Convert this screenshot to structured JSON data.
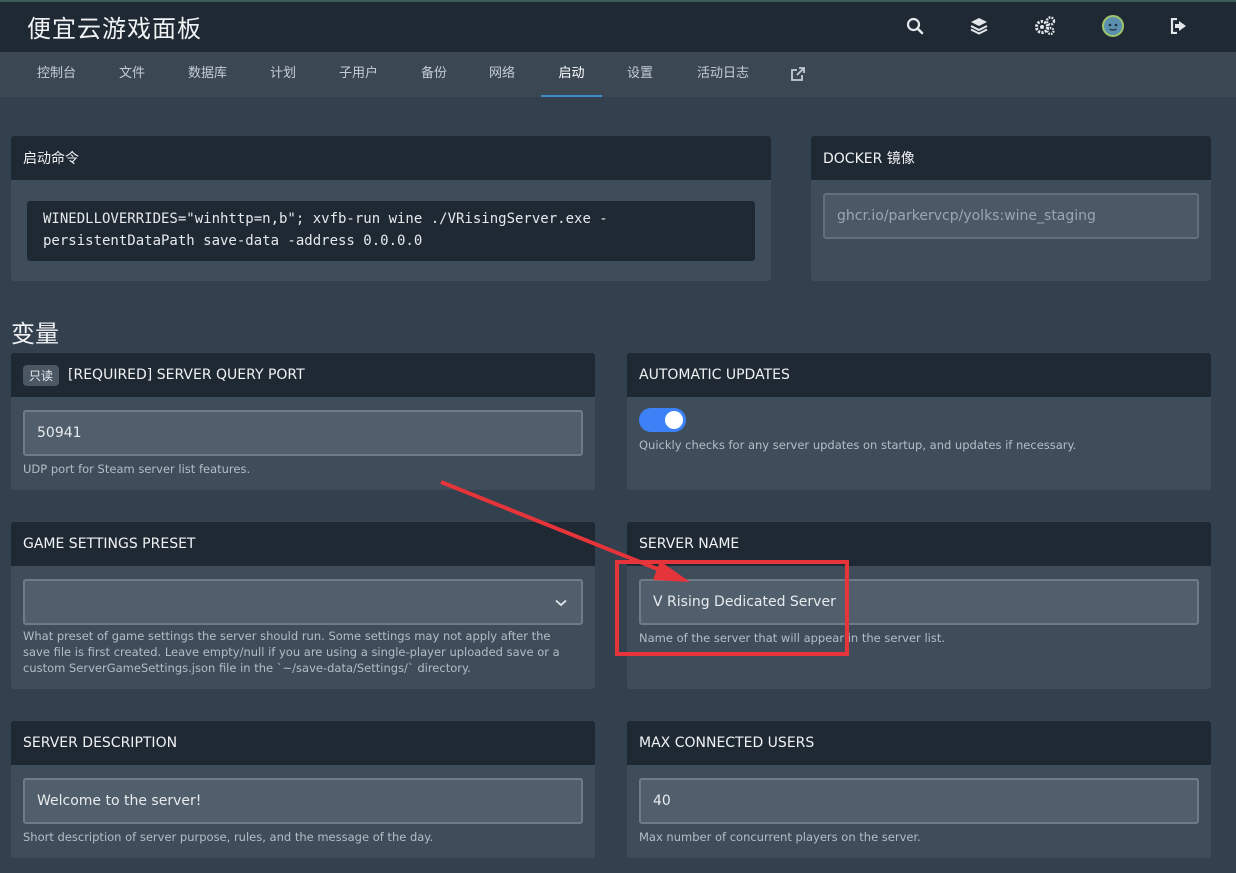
{
  "header": {
    "brand": "便宜云游戏面板",
    "icons": [
      "search-icon",
      "layers-icon",
      "cogs-icon",
      "avatar-icon",
      "logout-icon"
    ]
  },
  "nav": {
    "tabs": [
      {
        "label": "控制台"
      },
      {
        "label": "文件"
      },
      {
        "label": "数据库"
      },
      {
        "label": "计划"
      },
      {
        "label": "子用户"
      },
      {
        "label": "备份"
      },
      {
        "label": "网络"
      },
      {
        "label": "启动",
        "active": true
      },
      {
        "label": "设置"
      },
      {
        "label": "活动日志"
      }
    ],
    "external_icon": "external-link-icon"
  },
  "startup": {
    "title": "启动命令",
    "command_line1": "WINEDLLOVERRIDES=\"winhttp=n,b\"; xvfb-run wine ./VRisingServer.exe -",
    "command_line2": "persistentDataPath save-data -address 0.0.0.0"
  },
  "docker": {
    "title": "DOCKER 镜像",
    "image": "ghcr.io/parkervcp/yolks:wine_staging"
  },
  "variables": {
    "title": "变量",
    "query_port": {
      "badge": "只读",
      "label": "[REQUIRED] SERVER QUERY PORT",
      "value": "50941",
      "help": "UDP port for Steam server list features."
    },
    "auto_updates": {
      "label": "AUTOMATIC UPDATES",
      "enabled": true,
      "help": "Quickly checks for any server updates on startup, and updates if necessary."
    },
    "game_preset": {
      "label": "GAME SETTINGS PRESET",
      "value": "",
      "help_line1": "What preset of game settings the server should run. Some settings may not apply after the",
      "help_line2": "save file is first created. Leave empty/null if you are using a single-player uploaded save or a",
      "help_line3": "custom ServerGameSettings.json file in the `~/save-data/Settings/` directory."
    },
    "server_name": {
      "label": "SERVER NAME",
      "value": "V Rising Dedicated Server",
      "help": "Name of the server that will appear in the server list."
    },
    "server_description": {
      "label": "SERVER DESCRIPTION",
      "value": "Welcome to the server!",
      "help": "Short description of server purpose, rules, and the message of the day."
    },
    "max_users": {
      "label": "MAX CONNECTED USERS",
      "value": "40",
      "help": "Max number of concurrent players on the server."
    }
  },
  "colors": {
    "background": "#33404d",
    "header": "#1f2933",
    "accent": "#3d8dc8",
    "toggle_on": "#3c82f6",
    "annotation": "#e5343a"
  }
}
